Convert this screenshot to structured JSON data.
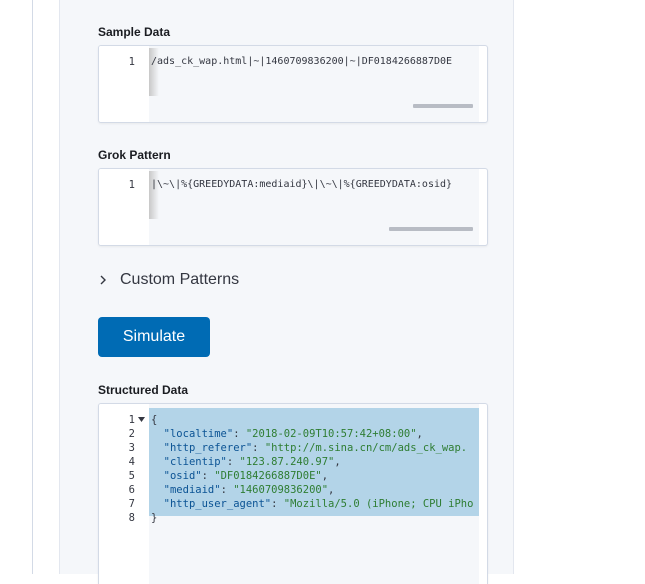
{
  "sample_data": {
    "label": "Sample Data",
    "line_number": "1",
    "text": "/ads_ck_wap.html|~|1460709836200|~|DF0184266887D0E"
  },
  "grok_pattern": {
    "label": "Grok Pattern",
    "line_number": "1",
    "text": "|\\~\\|%{GREEDYDATA:mediaid}\\|\\~\\|%{GREEDYDATA:osid}"
  },
  "custom_patterns": {
    "label": "Custom Patterns",
    "icon": "chevron-right-icon"
  },
  "simulate_button": {
    "label": "Simulate"
  },
  "structured_data": {
    "label": "Structured Data",
    "line_numbers": [
      "1",
      "2",
      "3",
      "4",
      "5",
      "6",
      "7",
      "8"
    ],
    "lines": {
      "l1": "{",
      "l2k": "\"localtime\"",
      "l2v": "\"2018-02-09T10:57:42+08:00\"",
      "l3k": "\"http_referer\"",
      "l3v": "\"http://m.sina.cn/cm/ads_ck_wap.",
      "l4k": "\"clientip\"",
      "l4v": "\"123.87.240.97\"",
      "l5k": "\"osid\"",
      "l5v": "\"DF0184266887D0E\"",
      "l6k": "\"mediaid\"",
      "l6v": "\"1460709836200\"",
      "l7k": "\"http_user_agent\"",
      "l7v": "\"Mozilla/5.0 (iPhone; CPU iPho",
      "l8": "}"
    }
  },
  "colors": {
    "accent": "#006bb4",
    "selection": "#b3d4e8",
    "json_key": "#0b5394",
    "json_string": "#2e7d32"
  }
}
